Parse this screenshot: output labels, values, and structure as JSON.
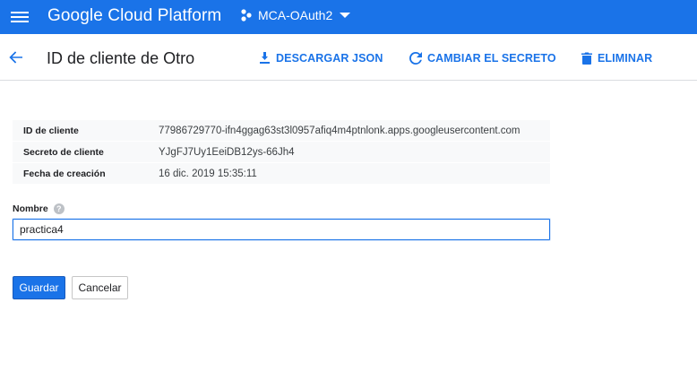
{
  "app": {
    "brand": "Google Cloud Platform",
    "project_name": "MCA-OAuth2",
    "accent_color": "#1a73e8"
  },
  "header": {
    "title": "ID de cliente de Otro",
    "actions": [
      {
        "label": "DESCARGAR JSON",
        "icon": "download-icon"
      },
      {
        "label": "CAMBIAR EL SECRETO",
        "icon": "refresh-icon"
      },
      {
        "label": "ELIMINAR",
        "icon": "trash-icon"
      }
    ]
  },
  "details": [
    {
      "key": "ID de cliente",
      "value": "77986729770-ifn4ggag63st3l0957afiq4m4ptnlonk.apps.googleusercontent.com"
    },
    {
      "key": "Secreto de cliente",
      "value": "YJgFJ7Uy1EeiDB12ys-66Jh4"
    },
    {
      "key": "Fecha de creación",
      "value": "16 dic. 2019 15:35:11"
    }
  ],
  "form": {
    "name_label": "Nombre",
    "name_value": "practica4",
    "help_glyph": "?"
  },
  "buttons": {
    "save": "Guardar",
    "cancel": "Cancelar"
  }
}
